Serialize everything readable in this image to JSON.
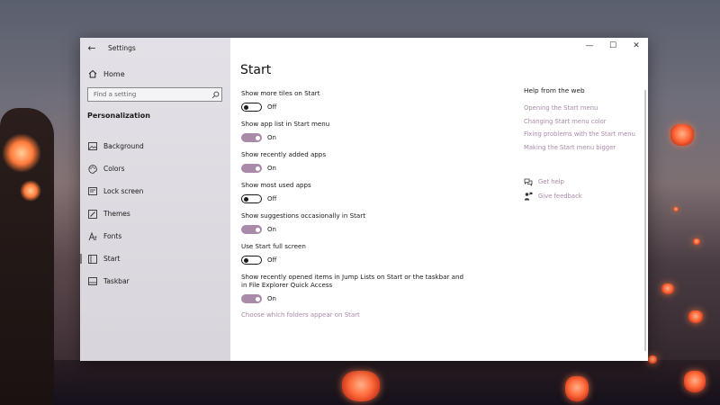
{
  "window": {
    "app_title": "Settings",
    "controls": {
      "minimize": "—",
      "maximize": "☐",
      "close": "✕"
    }
  },
  "sidebar": {
    "home_label": "Home",
    "search_placeholder": "Find a setting",
    "section_title": "Personalization",
    "items": [
      {
        "label": "Background",
        "icon": "image-icon"
      },
      {
        "label": "Colors",
        "icon": "palette-icon"
      },
      {
        "label": "Lock screen",
        "icon": "lock-screen-icon"
      },
      {
        "label": "Themes",
        "icon": "brush-icon"
      },
      {
        "label": "Fonts",
        "icon": "font-icon"
      },
      {
        "label": "Start",
        "icon": "start-icon",
        "active": true
      },
      {
        "label": "Taskbar",
        "icon": "taskbar-icon"
      }
    ]
  },
  "main": {
    "page_title": "Start",
    "settings": [
      {
        "label": "Show more tiles on Start",
        "on": false,
        "state": "Off"
      },
      {
        "label": "Show app list in Start menu",
        "on": true,
        "state": "On"
      },
      {
        "label": "Show recently added apps",
        "on": true,
        "state": "On"
      },
      {
        "label": "Show most used apps",
        "on": false,
        "state": "Off"
      },
      {
        "label": "Show suggestions occasionally in Start",
        "on": true,
        "state": "On"
      },
      {
        "label": "Use Start full screen",
        "on": false,
        "state": "Off"
      },
      {
        "label": "Show recently opened items in Jump Lists on Start or the taskbar and in File Explorer Quick Access",
        "on": true,
        "state": "On"
      }
    ],
    "folders_link": "Choose which folders appear on Start"
  },
  "help": {
    "title": "Help from the web",
    "links": [
      "Opening the Start menu",
      "Changing Start menu color",
      "Fixing problems with the Start menu",
      "Making the Start menu bigger"
    ],
    "get_help": "Get help",
    "give_feedback": "Give feedback"
  },
  "colors": {
    "accent": "#a98aa8",
    "toggle_off": "#1a1a1a"
  }
}
